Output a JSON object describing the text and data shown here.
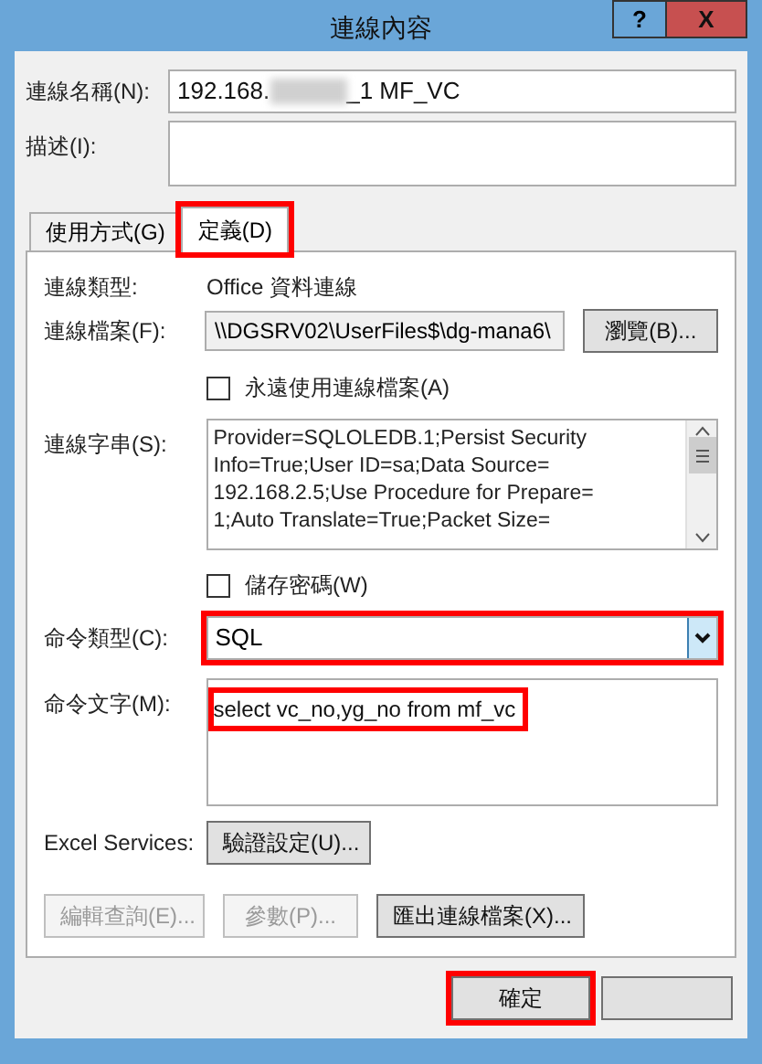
{
  "window": {
    "title": "連線內容",
    "help": "?",
    "close": "X"
  },
  "name_field": {
    "label": "連線名稱(N):",
    "value_start": "192.168.",
    "value_end": "_1 MF_VC",
    "redacted": true
  },
  "description_field": {
    "label": "描述(I):"
  },
  "tabs": [
    {
      "label": "使用方式(G)",
      "selected": false,
      "highlighted": false
    },
    {
      "label": "定義(D)",
      "selected": true,
      "highlighted": true
    }
  ],
  "connection_type": {
    "label": "連線類型:",
    "value": "Office 資料連線"
  },
  "connection_file": {
    "label": "連線檔案(F):",
    "value": "\\\\DGSRV02\\UserFiles$\\dg-mana6\\",
    "button": "瀏覽(B)..."
  },
  "always_use_file": {
    "label": "永遠使用連線檔案(A)",
    "checked": false
  },
  "connection_string": {
    "label": "連線字串(S):",
    "lines": [
      "Provider=SQLOLEDB.1;Persist Security",
      "Info=True;User ID=sa;Data Source=",
      "192.168.2.5;Use Procedure for Prepare=",
      "1;Auto Translate=True;Packet Size="
    ]
  },
  "save_password": {
    "label": "儲存密碼(W)",
    "checked": false
  },
  "command_type": {
    "label": "命令類型(C):",
    "value": "SQL",
    "highlighted": true
  },
  "command_text": {
    "label": "命令文字(M):",
    "value": "select vc_no,yg_no from mf_vc",
    "highlighted": true
  },
  "excel_services": {
    "label": "Excel Services:",
    "button": "驗證設定(U)..."
  },
  "panel_buttons": [
    {
      "label": "編輯查詢(E)...",
      "disabled": true
    },
    {
      "label": "參數(P)...",
      "disabled": true
    },
    {
      "label": "匯出連線檔案(X)...",
      "disabled": false
    }
  ],
  "footer_buttons": [
    {
      "kind": "ok",
      "label": "確定",
      "highlighted": true
    },
    {
      "kind": "cancel",
      "highlighted": false
    }
  ]
}
